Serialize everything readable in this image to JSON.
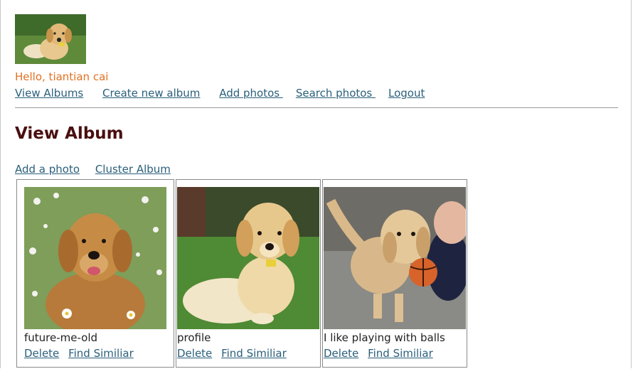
{
  "user": {
    "greeting": "Hello, tiantian cai",
    "avatar_icon": "puppy-avatar-image"
  },
  "nav": {
    "view_albums": "View Albums",
    "create_album": "Create new album",
    "add_photos": "Add photos ",
    "search_photos": "Search photos ",
    "logout": "Logout"
  },
  "page": {
    "title": "View Album"
  },
  "album_actions": {
    "add_photo": "Add a photo",
    "cluster": "Cluster Album"
  },
  "photos": [
    {
      "caption": "future-me-old",
      "delete": "Delete",
      "find_similar": "Find Similiar"
    },
    {
      "caption": "profile",
      "delete": "Delete",
      "find_similar": "Find Similiar"
    },
    {
      "caption": "I like playing with balls",
      "delete": "Delete",
      "find_similar": "Find Similiar"
    }
  ],
  "colors": {
    "greeting": "#e07222",
    "link": "#2a5f7b",
    "title": "#4a0f0f"
  }
}
